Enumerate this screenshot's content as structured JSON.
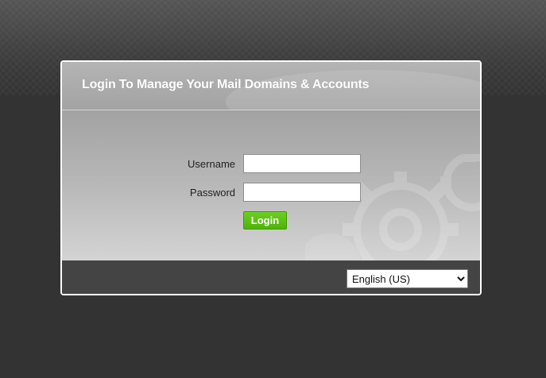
{
  "header": {
    "title": "Login To Manage Your Mail Domains & Accounts"
  },
  "form": {
    "username_label": "Username",
    "username_value": "",
    "password_label": "Password",
    "password_value": "",
    "login_label": "Login"
  },
  "footer": {
    "language_selected": "English (US)"
  },
  "colors": {
    "page_background": "#333333",
    "login_button": "#52b60a",
    "footer_background": "#444444"
  },
  "icons": [
    "gear-background-icon"
  ]
}
